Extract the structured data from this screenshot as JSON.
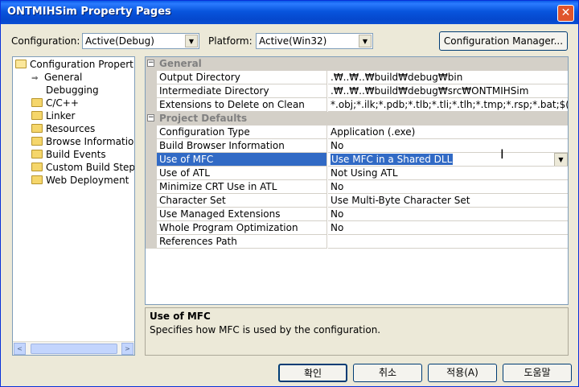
{
  "window": {
    "title": "ONTMIHSim Property Pages",
    "close_glyph": "✕"
  },
  "toolbar": {
    "configuration_label": "Configuration:",
    "configuration_value": "Active(Debug)",
    "platform_label": "Platform:",
    "platform_value": "Active(Win32)",
    "config_manager_label": "Configuration Manager..."
  },
  "tree": {
    "root": "Configuration Propertie",
    "items": [
      {
        "label": "General",
        "icon": "arrow-icon",
        "selected": true
      },
      {
        "label": "Debugging",
        "icon": "none"
      },
      {
        "label": "C/C++",
        "icon": "folder-icon"
      },
      {
        "label": "Linker",
        "icon": "folder-icon"
      },
      {
        "label": "Resources",
        "icon": "folder-icon"
      },
      {
        "label": "Browse Information",
        "icon": "folder-icon"
      },
      {
        "label": "Build Events",
        "icon": "folder-icon"
      },
      {
        "label": "Custom Build Step",
        "icon": "folder-icon"
      },
      {
        "label": "Web Deployment",
        "icon": "folder-icon"
      }
    ],
    "scroll_left": "<",
    "scroll_right": ">"
  },
  "grid": {
    "categories": [
      {
        "label": "General",
        "expander": "⊟"
      },
      {
        "label": "Project Defaults",
        "expander": "⊟"
      }
    ],
    "general_rows": [
      {
        "name": "Output Directory",
        "value": ".₩..₩..₩build₩debug₩bin"
      },
      {
        "name": "Intermediate Directory",
        "value": ".₩..₩..₩build₩debug₩src₩ONTMIHSim"
      },
      {
        "name": "Extensions to Delete on Clean",
        "value": "*.obj;*.ilk;*.pdb;*.tlb;*.tli;*.tlh;*.tmp;*.rsp;*.bat;$(Targ"
      }
    ],
    "defaults_rows": [
      {
        "name": "Configuration Type",
        "value": "Application (.exe)"
      },
      {
        "name": "Build Browser Information",
        "value": "No"
      },
      {
        "name": "Use of MFC",
        "value": "Use MFC in a Shared DLL",
        "selected": true
      },
      {
        "name": "Use of ATL",
        "value": "Not Using ATL"
      },
      {
        "name": "Minimize CRT Use in ATL",
        "value": "No"
      },
      {
        "name": "Character Set",
        "value": "Use Multi-Byte Character Set"
      },
      {
        "name": "Use Managed Extensions",
        "value": "No"
      },
      {
        "name": "Whole Program Optimization",
        "value": "No"
      },
      {
        "name": "References Path",
        "value": ""
      }
    ]
  },
  "description": {
    "title": "Use of MFC",
    "text": "Specifies how MFC is used by the configuration."
  },
  "buttons": {
    "ok": "확인",
    "cancel": "취소",
    "apply": "적용(A)",
    "help": "도움말"
  },
  "colors": {
    "selection": "#316ac5",
    "titlebar": "#0855dd"
  }
}
